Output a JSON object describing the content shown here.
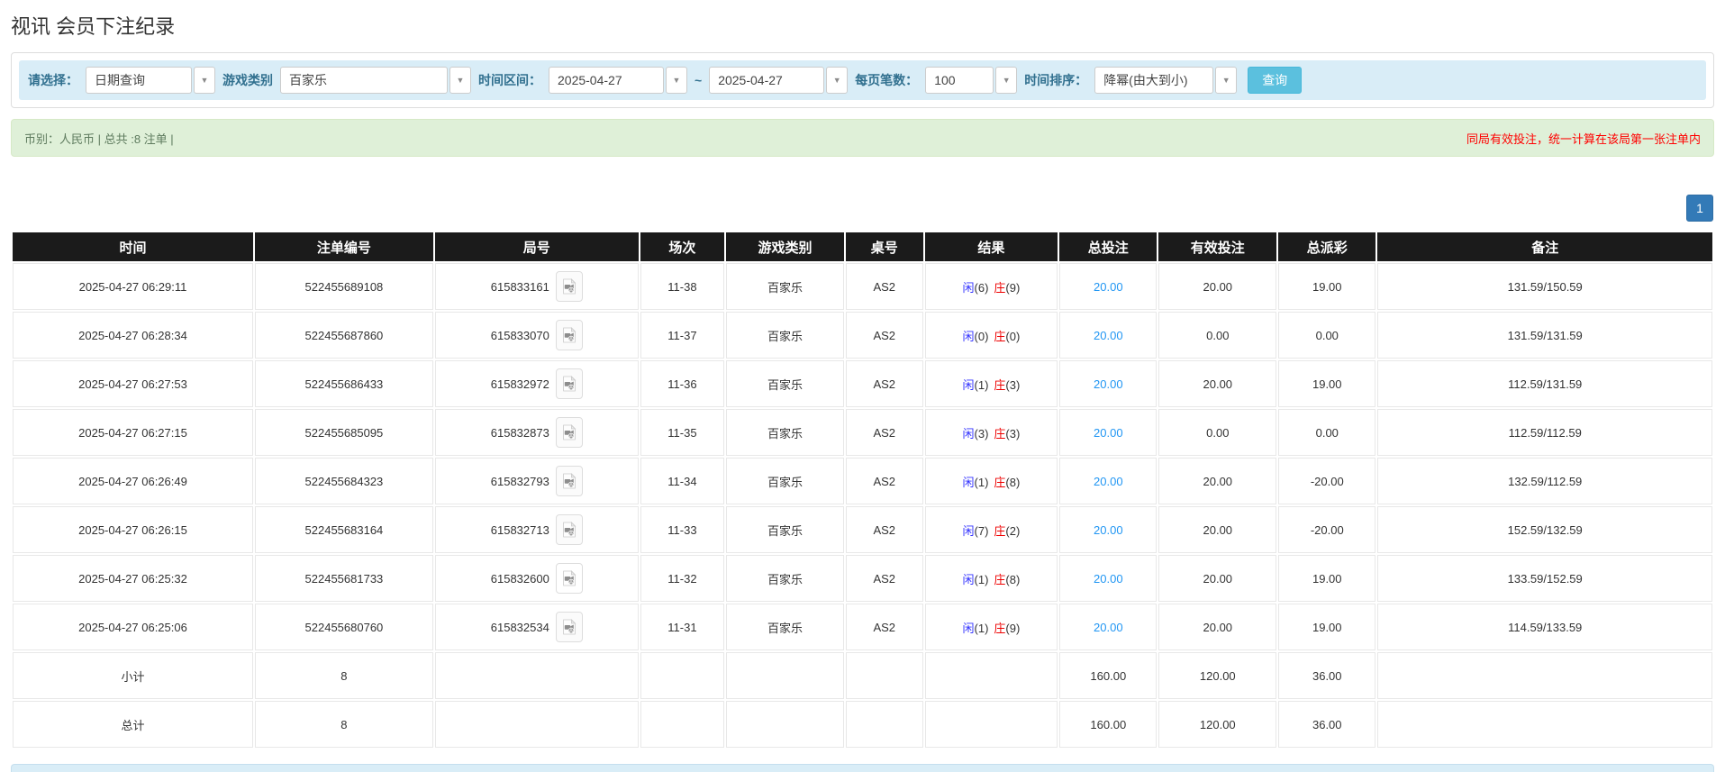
{
  "page": {
    "title": "视讯 会员下注纪录"
  },
  "filters": {
    "query_type_label": "请选择：",
    "query_type_value": "日期查询",
    "game_label": "游戏类别",
    "game_value": "百家乐",
    "range_label": "时间区间：",
    "date_from": "2025-04-27",
    "range_separator": "~",
    "date_to": "2025-04-27",
    "page_size_label": "每页笔数：",
    "page_size_value": "100",
    "sort_label": "时间排序：",
    "sort_value": "降幂(由大到小)",
    "search_button": "查询"
  },
  "summary": {
    "left": "币别：人民币 | 总共 :8 注单 |",
    "right_notice": "同局有效投注，统一计算在该局第一张注单内"
  },
  "pagination": {
    "current": "1"
  },
  "icons": {
    "combo_caret": "▼",
    "video_icon": "video-file-icon"
  },
  "colors": {
    "header_bg": "#1b1b1b",
    "highlight_row": "#ffff99",
    "subtotal_bg": "#999999",
    "link_blue": "#2196f3",
    "player_blue": "#3333ff",
    "banker_red": "#ee0000",
    "negative_red": "#ff0000",
    "search_button_bg": "#5bc0de",
    "pagination_bg": "#337ab7",
    "filter_bar_bg": "#d9edf7",
    "summary_bg": "#dff0d8"
  },
  "table": {
    "headers": [
      "时间",
      "注单编号",
      "局号",
      "场次",
      "游戏类别",
      "桌号",
      "结果",
      "总投注",
      "有效投注",
      "总派彩",
      "备注"
    ],
    "rows": [
      {
        "time": "2025-04-27 06:29:11",
        "bet_id": "522455689108",
        "round_id": "615833161",
        "session": "11-38",
        "game": "百家乐",
        "table_no": "AS2",
        "result_player": "闲",
        "result_player_score": "(6)",
        "result_banker": "庄",
        "result_banker_score": "(9)",
        "total_bet": "20.00",
        "valid_bet": "20.00",
        "payout": "19.00",
        "payout_negative": false,
        "note": "131.59/150.59",
        "highlighted": false
      },
      {
        "time": "2025-04-27 06:28:34",
        "bet_id": "522455687860",
        "round_id": "615833070",
        "session": "11-37",
        "game": "百家乐",
        "table_no": "AS2",
        "result_player": "闲",
        "result_player_score": "(0)",
        "result_banker": "庄",
        "result_banker_score": "(0)",
        "total_bet": "20.00",
        "valid_bet": "0.00",
        "payout": "0.00",
        "payout_negative": false,
        "note": "131.59/131.59",
        "highlighted": false
      },
      {
        "time": "2025-04-27 06:27:53",
        "bet_id": "522455686433",
        "round_id": "615832972",
        "session": "11-36",
        "game": "百家乐",
        "table_no": "AS2",
        "result_player": "闲",
        "result_player_score": "(1)",
        "result_banker": "庄",
        "result_banker_score": "(3)",
        "total_bet": "20.00",
        "valid_bet": "20.00",
        "payout": "19.00",
        "payout_negative": false,
        "note": "112.59/131.59",
        "highlighted": false
      },
      {
        "time": "2025-04-27 06:27:15",
        "bet_id": "522455685095",
        "round_id": "615832873",
        "session": "11-35",
        "game": "百家乐",
        "table_no": "AS2",
        "result_player": "闲",
        "result_player_score": "(3)",
        "result_banker": "庄",
        "result_banker_score": "(3)",
        "total_bet": "20.00",
        "valid_bet": "0.00",
        "payout": "0.00",
        "payout_negative": false,
        "note": "112.59/112.59",
        "highlighted": false
      },
      {
        "time": "2025-04-27 06:26:49",
        "bet_id": "522455684323",
        "round_id": "615832793",
        "session": "11-34",
        "game": "百家乐",
        "table_no": "AS2",
        "result_player": "闲",
        "result_player_score": "(1)",
        "result_banker": "庄",
        "result_banker_score": "(8)",
        "total_bet": "20.00",
        "valid_bet": "20.00",
        "payout": "-20.00",
        "payout_negative": true,
        "note": "132.59/112.59",
        "highlighted": false
      },
      {
        "time": "2025-04-27 06:26:15",
        "bet_id": "522455683164",
        "round_id": "615832713",
        "session": "11-33",
        "game": "百家乐",
        "table_no": "AS2",
        "result_player": "闲",
        "result_player_score": "(7)",
        "result_banker": "庄",
        "result_banker_score": "(2)",
        "total_bet": "20.00",
        "valid_bet": "20.00",
        "payout": "-20.00",
        "payout_negative": true,
        "note": "152.59/132.59",
        "highlighted": false
      },
      {
        "time": "2025-04-27 06:25:32",
        "bet_id": "522455681733",
        "round_id": "615832600",
        "session": "11-32",
        "game": "百家乐",
        "table_no": "AS2",
        "result_player": "闲",
        "result_player_score": "(1)",
        "result_banker": "庄",
        "result_banker_score": "(8)",
        "total_bet": "20.00",
        "valid_bet": "20.00",
        "payout": "19.00",
        "payout_negative": false,
        "note": "133.59/152.59",
        "highlighted": true
      },
      {
        "time": "2025-04-27 06:25:06",
        "bet_id": "522455680760",
        "round_id": "615832534",
        "session": "11-31",
        "game": "百家乐",
        "table_no": "AS2",
        "result_player": "闲",
        "result_player_score": "(1)",
        "result_banker": "庄",
        "result_banker_score": "(9)",
        "total_bet": "20.00",
        "valid_bet": "20.00",
        "payout": "19.00",
        "payout_negative": false,
        "note": "114.59/133.59",
        "highlighted": false
      }
    ],
    "subtotal": {
      "label": "小计",
      "count": "8",
      "total_bet": "160.00",
      "valid_bet": "120.00",
      "payout": "36.00"
    },
    "total": {
      "label": "总计",
      "count": "8",
      "total_bet": "160.00",
      "valid_bet": "120.00",
      "payout": "36.00"
    }
  }
}
